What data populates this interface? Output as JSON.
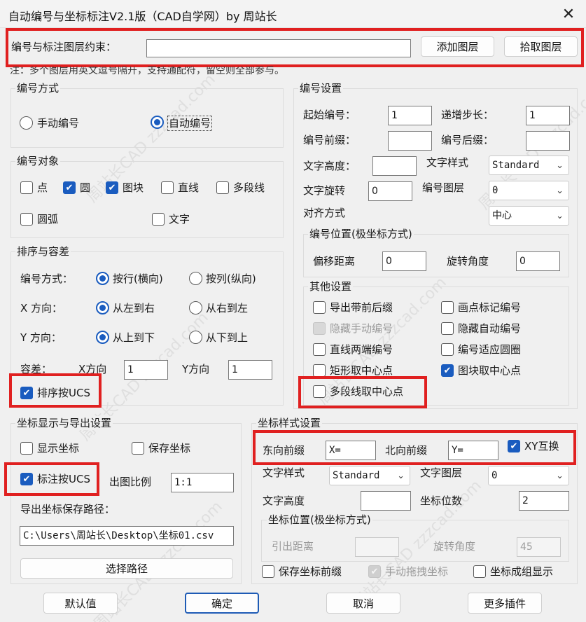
{
  "window": {
    "title": "自动编号与坐标标注V2.1版（CAD自学网）by 周站长"
  },
  "top": {
    "layer_label": "编号与标注图层约束：",
    "layer_value": "",
    "add_layer": "添加图层",
    "pick_layer": "拾取图层",
    "note": "注：多个图层用英文逗号隔开，支持通配符，留空则全部参与。"
  },
  "numbering_mode": {
    "title": "编号方式",
    "manual": "手动编号",
    "auto": "自动编号",
    "selected": "auto"
  },
  "number_objects": {
    "title": "编号对象",
    "items": [
      {
        "label": "点",
        "checked": false
      },
      {
        "label": "圆",
        "checked": true
      },
      {
        "label": "图块",
        "checked": true
      },
      {
        "label": "直线",
        "checked": false
      },
      {
        "label": "多段线",
        "checked": false
      },
      {
        "label": "圆弧",
        "checked": false
      },
      {
        "label": "文字",
        "checked": false
      }
    ]
  },
  "sorting": {
    "title": "排序与容差",
    "mode_label": "编号方式：",
    "by_row": "按行(横向)",
    "by_col": "按列(纵向)",
    "x_label": "X 方向：",
    "x_lr": "从左到右",
    "x_rl": "从右到左",
    "y_label": "Y 方向：",
    "y_tb": "从上到下",
    "y_bt": "从下到上",
    "tol_label": "容差：",
    "tol_x_label": "X方向",
    "tol_x": "1",
    "tol_y_label": "Y方向",
    "tol_y": "1",
    "ucs_sort": "排序按UCS"
  },
  "number_settings": {
    "title": "编号设置",
    "start_label": "起始编号：",
    "start": "1",
    "step_label": "递增步长：",
    "step": "1",
    "prefix_label": "编号前缀：",
    "prefix": "",
    "suffix_label": "编号后缀：",
    "suffix": "",
    "text_height_label": "文字高度：",
    "text_height": "",
    "text_style_label": "文字样式",
    "text_style": "Standard",
    "text_rotate_label": "文字旋转",
    "text_rotate": "0",
    "layer_label": "编号图层",
    "layer": "0",
    "align_label": "对齐方式",
    "align": "中心",
    "position_title": "编号位置(极坐标方式)",
    "offset_label": "偏移距离",
    "offset": "0",
    "angle_label": "旋转角度",
    "angle": "0"
  },
  "other_settings": {
    "title": "其他设置",
    "export_prefix": "导出带前后缀",
    "draw_point": "画点标记编号",
    "hide_manual": "隐藏手动编号",
    "hide_auto": "隐藏自动编号",
    "line_ends": "直线两端编号",
    "fit_circle": "编号适应圆圈",
    "rect_center": "矩形取中心点",
    "block_center": "图块取中心点",
    "pline_center": "多段线取中心点"
  },
  "coord_export": {
    "title": "坐标显示与导出设置",
    "show_coord": "显示坐标",
    "save_coord": "保存坐标",
    "ucs_label": "标注按UCS",
    "scale_label": "出图比例",
    "scale": "1:1",
    "path_label": "导出坐标保存路径：",
    "path": "C:\\Users\\周站长\\Desktop\\坐标01.csv",
    "choose_path": "选择路径"
  },
  "coord_style": {
    "title": "坐标样式设置",
    "east_label": "东向前缀",
    "east": "X=",
    "north_label": "北向前缀",
    "north": "Y=",
    "xy_swap": "XY互换",
    "text_style_label": "文字样式",
    "text_style": "Standard",
    "layer_label": "文字图层",
    "layer": "0",
    "text_height_label": "文字高度",
    "text_height": "",
    "digits_label": "坐标位数",
    "digits": "2",
    "position_title": "坐标位置(极坐标方式)",
    "lead_label": "引出距离",
    "lead": "",
    "angle_label": "旋转角度",
    "angle": "45",
    "save_prefix": "保存坐标前缀",
    "drag": "手动拖拽坐标",
    "group": "坐标成组显示"
  },
  "footer": {
    "default": "默认值",
    "ok": "确定",
    "cancel": "取消",
    "more": "更多插件"
  },
  "watermark": {
    "text": "周站长CAD  zzzcad.com"
  },
  "colors": {
    "highlight": "#e02020",
    "accent": "#1a5cbf"
  }
}
